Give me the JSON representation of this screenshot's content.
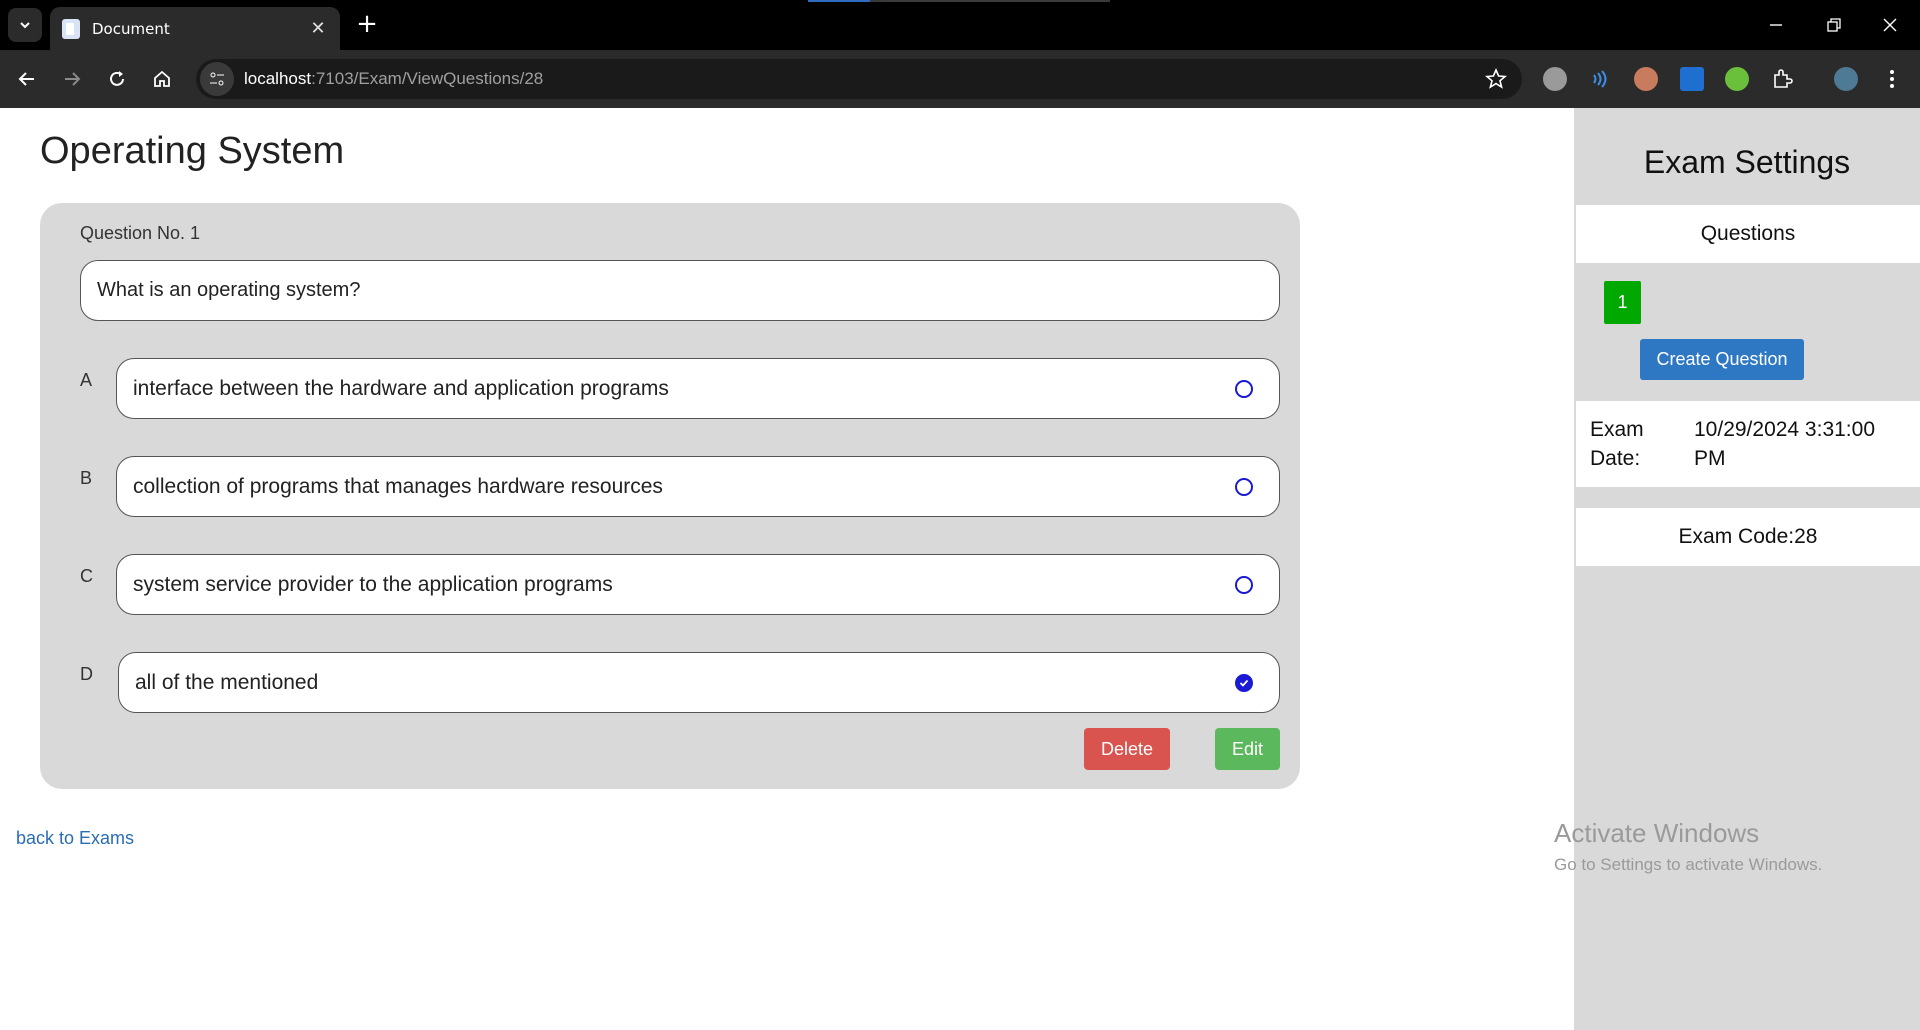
{
  "browser": {
    "tab_title": "Document",
    "tab_close": "✕",
    "new_tab": "+",
    "url_host": "localhost",
    "url_path": ":7103/Exam/ViewQuestions/28"
  },
  "page": {
    "title": "Operating System",
    "question": {
      "number_label": "Question No. 1",
      "text": "What is an operating system?",
      "options": [
        {
          "letter": "A",
          "text": "interface between the hardware and application programs",
          "selected": false
        },
        {
          "letter": "B",
          "text": "collection of programs that manages hardware resources",
          "selected": false
        },
        {
          "letter": "C",
          "text": "system service provider to the application programs",
          "selected": false
        },
        {
          "letter": "D",
          "text": "all of the mentioned",
          "selected": true
        }
      ],
      "delete_label": "Delete",
      "edit_label": "Edit"
    },
    "back_link": "back to Exams"
  },
  "sidebar": {
    "title": "Exam Settings",
    "questions_header": "Questions",
    "question_chips": [
      "1"
    ],
    "create_button": "Create Question",
    "exam_date_label": "Exam Date:",
    "exam_date_value": "10/29/2024 3:31:00 PM",
    "exam_code": "Exam Code:28"
  },
  "watermark": {
    "line1": "Activate Windows",
    "line2": "Go to Settings to activate Windows."
  },
  "colors": {
    "delete": "#d9534f",
    "edit": "#5cb85c",
    "chip": "#00a800",
    "create": "#2e78c3",
    "link": "#2a6db5",
    "radio": "#1a1ad4"
  }
}
